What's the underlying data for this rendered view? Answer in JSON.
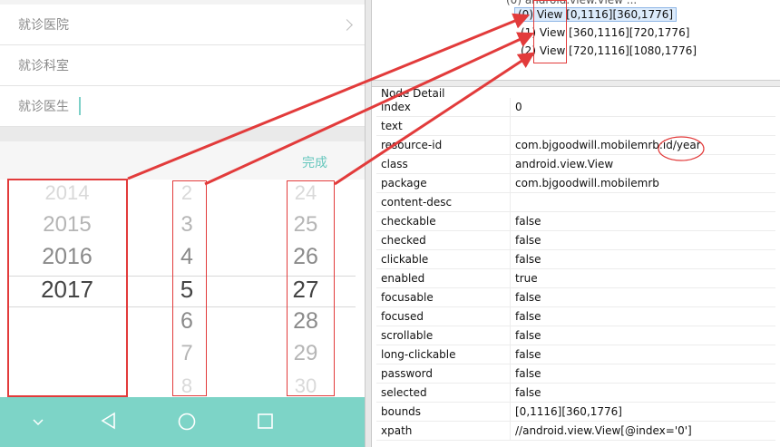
{
  "phone": {
    "form_rows": [
      {
        "label": "就诊医院",
        "has_chevron": true
      },
      {
        "label": "就诊科室",
        "has_chevron": false
      },
      {
        "label": "就诊医生",
        "has_chevron": false
      }
    ],
    "picker": {
      "done_label": "完成",
      "columns": [
        {
          "name": "year",
          "items": [
            "2014",
            "2015",
            "2016",
            "2017"
          ],
          "selected": "2017"
        },
        {
          "name": "month",
          "items": [
            "2",
            "3",
            "4",
            "5",
            "6",
            "7",
            "8"
          ],
          "selected": "5"
        },
        {
          "name": "day",
          "items": [
            "24",
            "25",
            "26",
            "27",
            "28",
            "29",
            "30"
          ],
          "selected": "27"
        }
      ]
    },
    "nav_icons": [
      "chevron-down-icon",
      "back-icon",
      "home-icon",
      "recents-icon"
    ],
    "accent_color": "#7dd4c7"
  },
  "tree": {
    "rows": [
      {
        "index": "(0)",
        "cls": "View",
        "bounds": "[0,1116][360,1776]",
        "selected": true
      },
      {
        "index": "(1)",
        "cls": "View",
        "bounds": "[360,1116][720,1776]",
        "selected": false
      },
      {
        "index": "(2)",
        "cls": "View",
        "bounds": "[720,1116][1080,1776]",
        "selected": false
      }
    ]
  },
  "node_detail": {
    "title": "Node Detail",
    "rows": [
      {
        "key": "index",
        "value": "0"
      },
      {
        "key": "text",
        "value": ""
      },
      {
        "key": "resource-id",
        "value": "com.bjgoodwill.mobilemrb:id/year"
      },
      {
        "key": "class",
        "value": "android.view.View"
      },
      {
        "key": "package",
        "value": "com.bjgoodwill.mobilemrb"
      },
      {
        "key": "content-desc",
        "value": ""
      },
      {
        "key": "checkable",
        "value": "false"
      },
      {
        "key": "checked",
        "value": "false"
      },
      {
        "key": "clickable",
        "value": "false"
      },
      {
        "key": "enabled",
        "value": "true"
      },
      {
        "key": "focusable",
        "value": "false"
      },
      {
        "key": "focused",
        "value": "false"
      },
      {
        "key": "scrollable",
        "value": "false"
      },
      {
        "key": "long-clickable",
        "value": "false"
      },
      {
        "key": "password",
        "value": "false"
      },
      {
        "key": "selected",
        "value": "false"
      },
      {
        "key": "bounds",
        "value": "[0,1116][360,1776]"
      },
      {
        "key": "xpath",
        "value": "//android.view.View[@index='0']"
      }
    ]
  },
  "annotation_color": "#e23b3b"
}
